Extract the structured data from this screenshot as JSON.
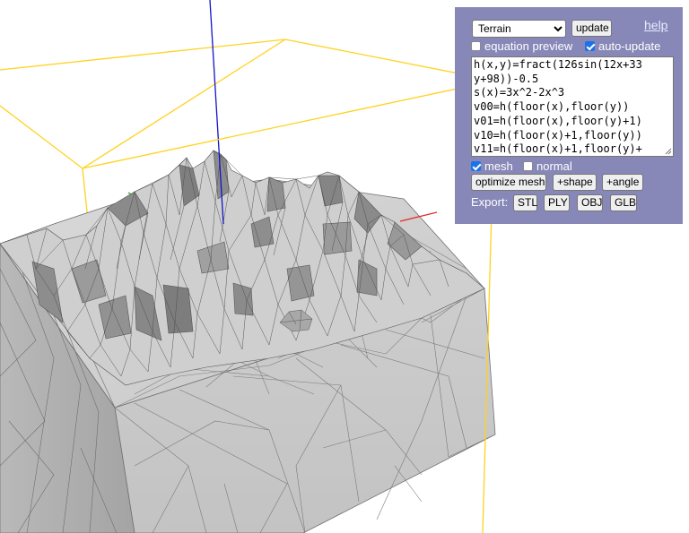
{
  "viewport": {
    "colors": {
      "bounding_box": "#ffd21f",
      "y_axis": "#1414c8",
      "x_axis": "#e62828",
      "z_axis": "#1e9e1e",
      "mesh_fill": "#c9c9c9",
      "mesh_wire": "#6e6e6e",
      "panel_bg": "#8787b8"
    }
  },
  "panel": {
    "preset": {
      "selected": "Terrain",
      "options": [
        "Terrain"
      ]
    },
    "update_label": "update",
    "help_label": "help",
    "equation_preview": {
      "label": "equation preview",
      "checked": false
    },
    "auto_update": {
      "label": "auto-update",
      "checked": true
    },
    "equation_lines": [
      "h(x,y)=fract(126sin(12x+33",
      "y+98))-0.5",
      "s(x)=3x^2-2x^3",
      "v00=h(floor(x),floor(y))",
      "v01=h(floor(x),floor(y)+1)",
      "v10=h(floor(x)+1,floor(y))",
      "v11=h(floor(x)+1,floor(y)+"
    ],
    "mesh": {
      "label": "mesh",
      "checked": true
    },
    "normal": {
      "label": "normal",
      "checked": false
    },
    "optimize_label": "optimize mesh",
    "shape_label": "+shape",
    "angle_label": "+angle",
    "export_label": "Export:",
    "export_formats": [
      "STL",
      "PLY",
      "OBJ",
      "GLB"
    ]
  }
}
